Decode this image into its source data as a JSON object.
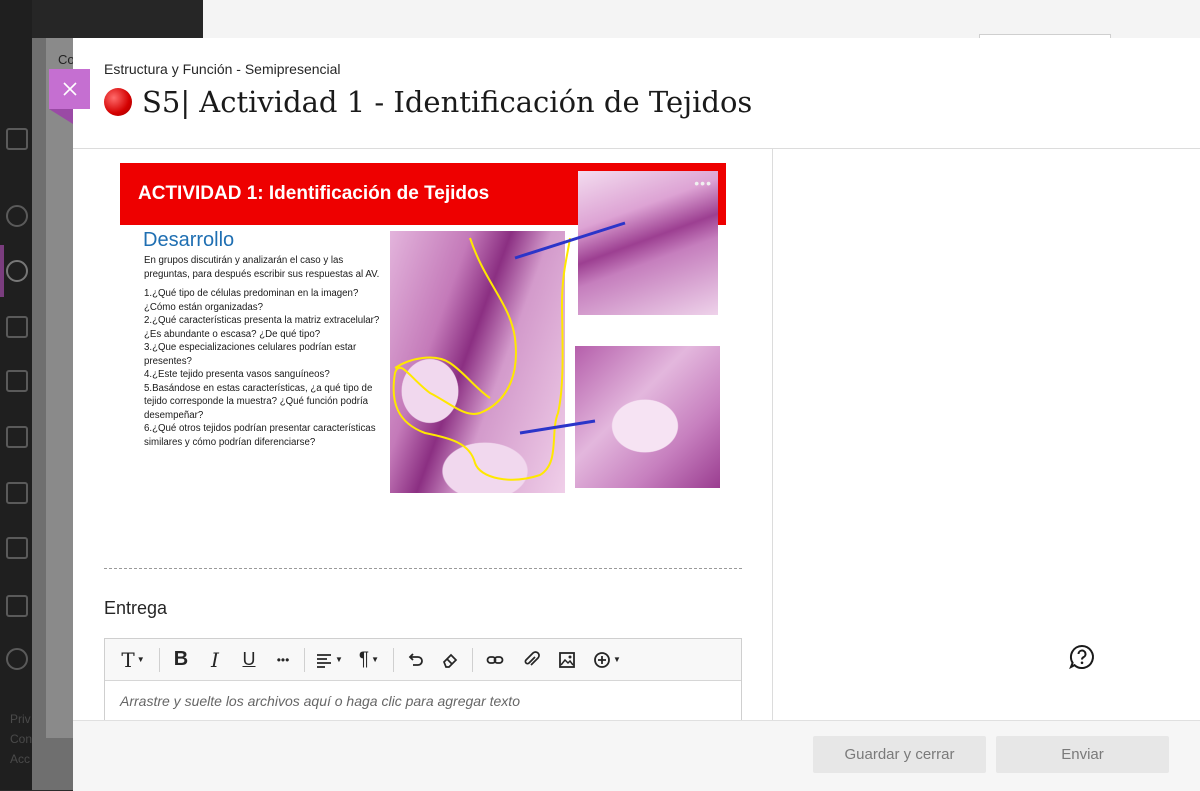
{
  "background": {
    "partial_label": "Co",
    "footer_links": [
      "Priv",
      "Con",
      "Acc"
    ]
  },
  "header": {
    "course": "Estructura y Función - Semipresencial",
    "title": "S5| Actividad 1 - Identificación de Tejidos"
  },
  "slide": {
    "banner_title": "ACTIVIDAD 1: Identificación de Tejidos",
    "more_menu": "•••",
    "heading": "Desarrollo",
    "intro": "En grupos discutirán y analizarán el caso y las preguntas, para después escribir sus respuestas al AV.",
    "questions": [
      "1.¿Qué tipo de células predominan en la imagen? ¿Cómo están organizadas?",
      "2.¿Qué características presenta la matriz extracelular? ¿Es abundante o escasa? ¿De qué tipo?",
      "3.¿Que especializaciones celulares podrían estar presentes?",
      "4.¿Este tejido presenta vasos sanguíneos?",
      "5.Basándose en estas características, ¿a qué tipo de tejido corresponde la muestra? ¿Qué función podría desempeñar?",
      "6.¿Qué otros tejidos podrían presentar características similares y cómo podrían diferenciarse?"
    ]
  },
  "submission": {
    "heading": "Entrega",
    "placeholder": "Arrastre y suelte los archivos aquí o haga clic para agregar texto",
    "toolbar": {
      "text_style": "T",
      "bold": "B",
      "italic": "I",
      "underline": "U",
      "more": "•••",
      "paragraph": "¶"
    }
  },
  "footer": {
    "save_label": "Guardar y cerrar",
    "submit_label": "Enviar"
  },
  "icons": [
    "close-icon",
    "text-style-icon",
    "bold-icon",
    "italic-icon",
    "underline-icon",
    "more-icon",
    "align-icon",
    "paragraph-icon",
    "undo-icon",
    "eraser-icon",
    "link-icon",
    "attach-icon",
    "image-icon",
    "add-icon",
    "help-icon"
  ],
  "colors": {
    "accent": "#c56fd1",
    "banner": "#ee0000",
    "heading_blue": "#1f6fb2"
  }
}
